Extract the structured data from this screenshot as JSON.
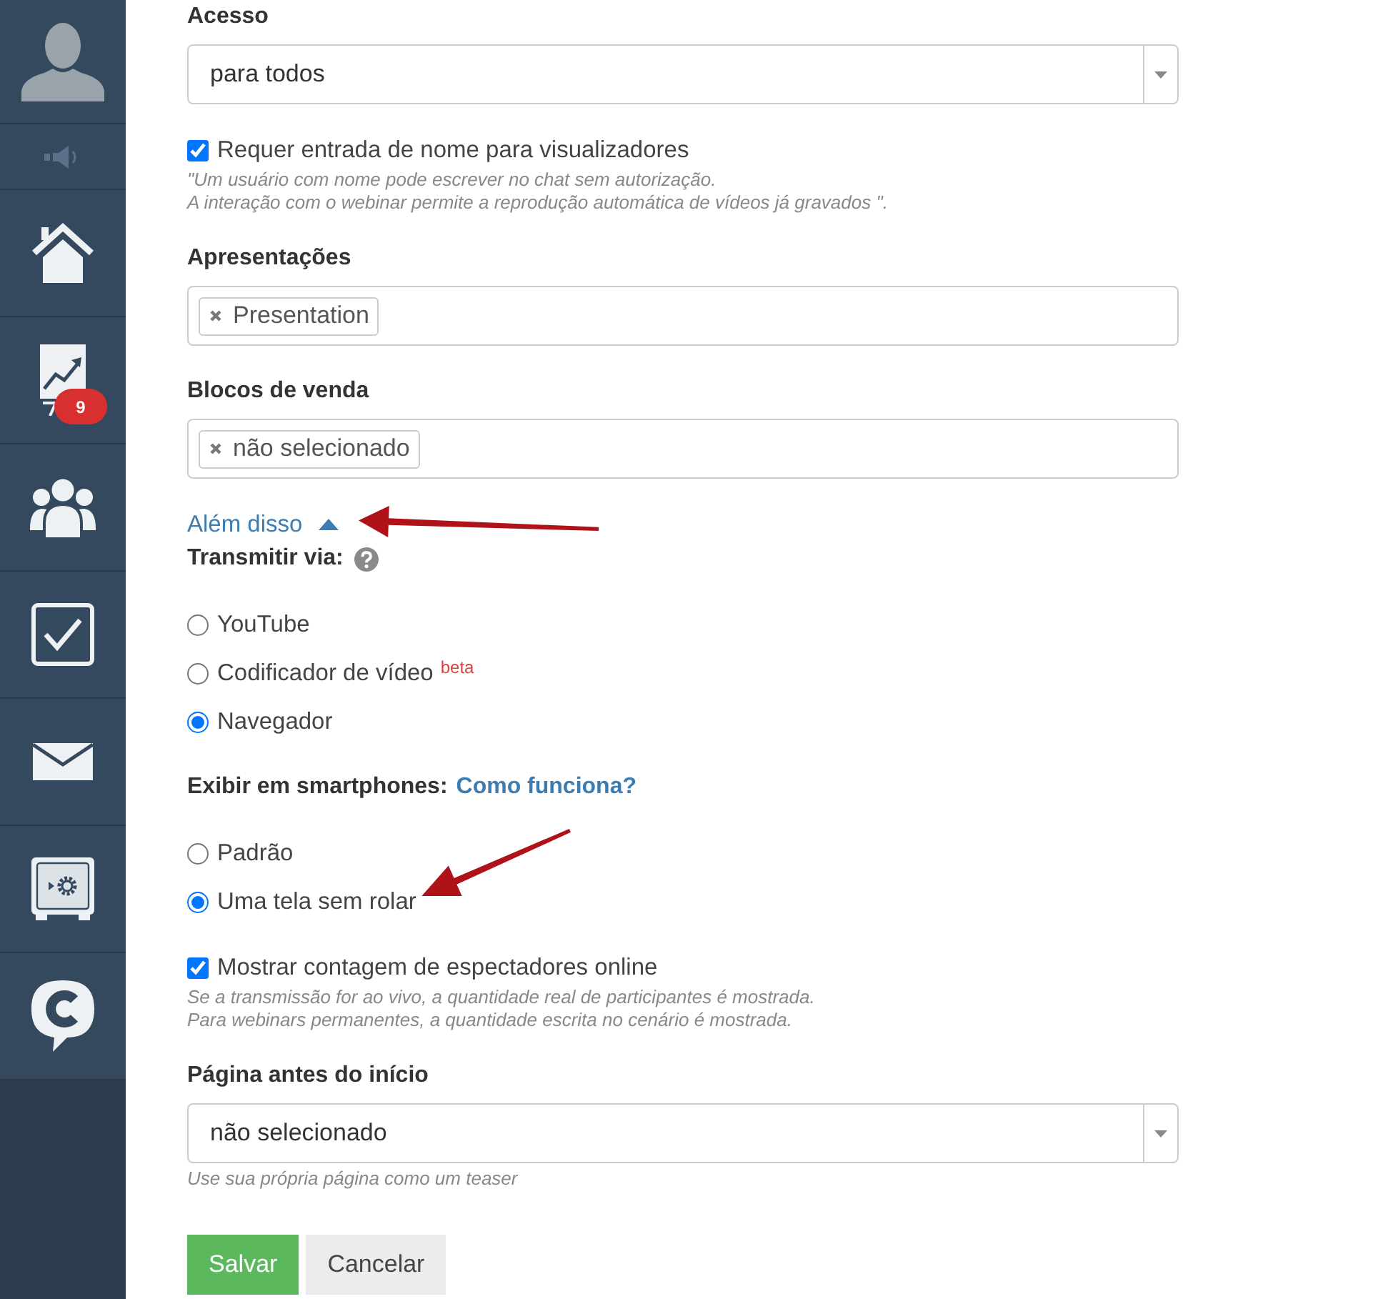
{
  "sidebar": {
    "items": [
      {
        "kind": "avatar"
      },
      {
        "kind": "sound"
      },
      {
        "kind": "home"
      },
      {
        "kind": "chart",
        "badge": "9"
      },
      {
        "kind": "users"
      },
      {
        "kind": "tasks"
      },
      {
        "kind": "mail"
      },
      {
        "kind": "safe"
      },
      {
        "kind": "chat"
      }
    ]
  },
  "form": {
    "fields": [
      {
        "kind": "select",
        "label": "Acesso",
        "value": "para todos"
      },
      {
        "kind": "checkbox",
        "label": "Requer entrada de nome para visualizadores",
        "checked": true,
        "hint": [
          "\"Um usuário com nome pode escrever no chat sem autorização.",
          "A interação com o webinar permite a reprodução automática de vídeos já gravados \"."
        ]
      },
      {
        "kind": "tags",
        "label": "Apresentações",
        "tags": [
          "Presentation"
        ]
      },
      {
        "kind": "tags",
        "label": "Blocos de venda",
        "tags": [
          "não selecionado"
        ]
      },
      {
        "kind": "toggle",
        "label": "Além disso",
        "expanded": true,
        "pointed_by_arrow": true
      },
      {
        "kind": "radio_group",
        "label": "Transmitir via:",
        "help": true,
        "options": [
          {
            "label": "YouTube",
            "selected": false
          },
          {
            "label": "Codificador de vídeo",
            "badge": "beta",
            "selected": false
          },
          {
            "label": "Navegador",
            "selected": true
          }
        ]
      },
      {
        "kind": "radio_group",
        "label": "Exibir em smartphones:",
        "link": "Como funciona?",
        "options": [
          {
            "label": "Padrão",
            "selected": false
          },
          {
            "label": "Uma tela sem rolar",
            "selected": true,
            "pointed_by_arrow": true
          }
        ]
      },
      {
        "kind": "checkbox",
        "label": "Mostrar contagem de espectadores online",
        "checked": true,
        "hint": [
          "Se a transmissão for ao vivo, a quantidade real de participantes é mostrada.",
          "Para webinars permanentes, a quantidade escrita no cenário é mostrada."
        ]
      },
      {
        "kind": "select",
        "label": "Página antes do início",
        "value": "não selecionado",
        "hint": [
          "Use sua própria página como um teaser"
        ]
      }
    ]
  },
  "buttons": [
    {
      "kind": "primary",
      "label": "Salvar"
    },
    {
      "kind": "secondary",
      "label": "Cancelar"
    }
  ]
}
